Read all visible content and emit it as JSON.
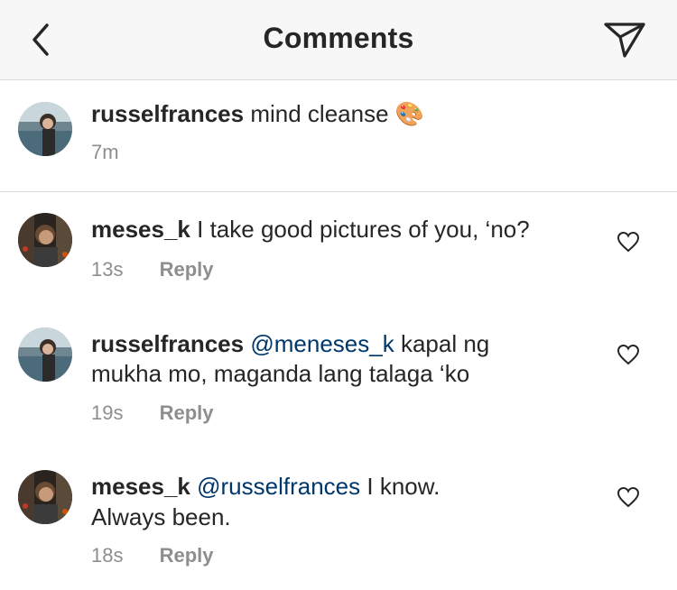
{
  "header": {
    "title": "Comments",
    "back_icon": "chevron-left-icon",
    "share_icon": "paper-plane-icon"
  },
  "caption": {
    "username": "russelfrances",
    "text": "mind cleanse",
    "emoji": "🎨",
    "time": "7m"
  },
  "comments": [
    {
      "username": "meses_k",
      "mention": "",
      "line1": "I take good pictures of you, ‘no?",
      "line2": "",
      "time": "13s",
      "reply_label": "Reply"
    },
    {
      "username": "russelfrances",
      "mention": "@meneses_k",
      "line1": "kapal ng",
      "line2": "mukha mo, maganda lang talaga ‘ko",
      "time": "19s",
      "reply_label": "Reply"
    },
    {
      "username": "meses_k",
      "mention": "@russelfrances",
      "line1": "I know.",
      "line2": "Always been.",
      "time": "18s",
      "reply_label": "Reply"
    }
  ],
  "colors": {
    "header_bg": "#f7f7f7",
    "text": "#262626",
    "secondary": "#8e8e8e",
    "mention": "#00376b",
    "divider": "#dbdbdb"
  }
}
